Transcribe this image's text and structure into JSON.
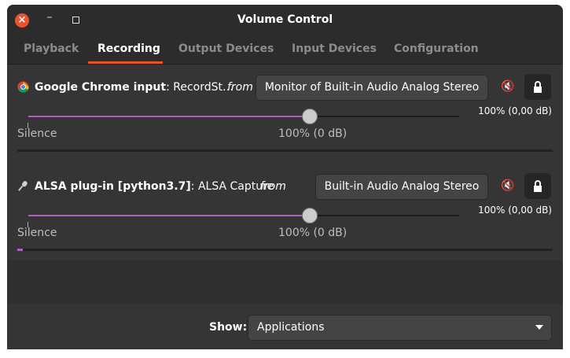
{
  "window": {
    "title": "Volume Control"
  },
  "tabs": [
    {
      "label": "Playback"
    },
    {
      "label": "Recording"
    },
    {
      "label": "Output Devices"
    },
    {
      "label": "Input Devices"
    },
    {
      "label": "Configuration"
    }
  ],
  "streams": [
    {
      "app_bold": "Google Chrome input",
      "app_detail": ": RecordSt…",
      "from": "from",
      "device": "Monitor of Built-in Audio Analog Stereo",
      "volume_readout": "100% (0,00 dB)",
      "silence_label": "Silence",
      "center_label": "100% (0 dB)",
      "volume_percent": 100,
      "meter_level": 0
    },
    {
      "app_bold": "ALSA plug-in [python3.7]",
      "app_detail": ": ALSA Capture",
      "from": "from",
      "device": "Built-in Audio Analog Stereo",
      "volume_readout": "100% (0,00 dB)",
      "silence_label": "Silence",
      "center_label": "100% (0 dB)",
      "volume_percent": 100,
      "meter_level": 0.01
    }
  ],
  "footer": {
    "show_label": "Show:",
    "show_value": "Applications"
  },
  "colors": {
    "accent": "#e95420",
    "slider": "#b15ec2",
    "close": "#e9542f"
  }
}
